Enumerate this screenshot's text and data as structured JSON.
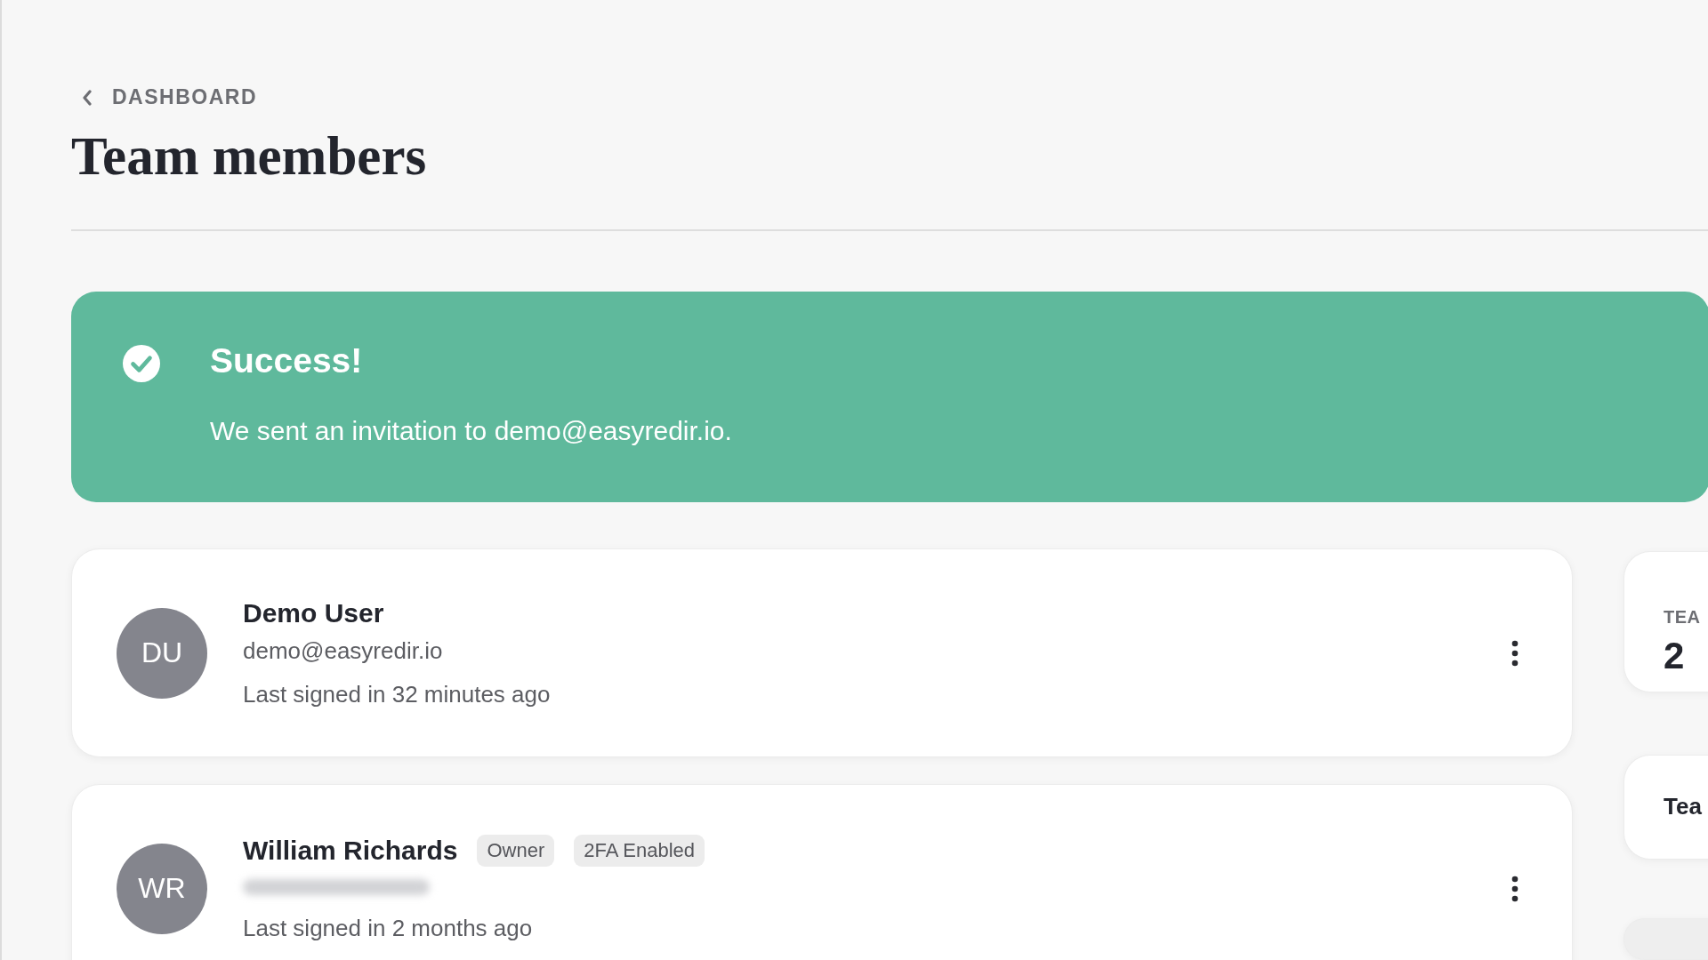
{
  "breadcrumb": {
    "label": "DASHBOARD"
  },
  "title": "Team members",
  "alert": {
    "kind": "success",
    "title": "Success!",
    "message": "We sent an invitation to demo@easyredir.io."
  },
  "members": [
    {
      "initials": "DU",
      "name": "Demo User",
      "email": "demo@easyredir.io",
      "last_signed": "Last signed in 32 minutes ago"
    },
    {
      "initials": "WR",
      "name": "William Richards",
      "badges": [
        "Owner",
        "2FA Enabled"
      ],
      "email_hidden": true,
      "last_signed": "Last signed in 2 months ago"
    }
  ],
  "side_cards": [
    {
      "kind": "stat",
      "label": "TEA",
      "value": "2"
    },
    {
      "kind": "link",
      "label": "Tea"
    },
    {
      "kind": "blank"
    }
  ]
}
